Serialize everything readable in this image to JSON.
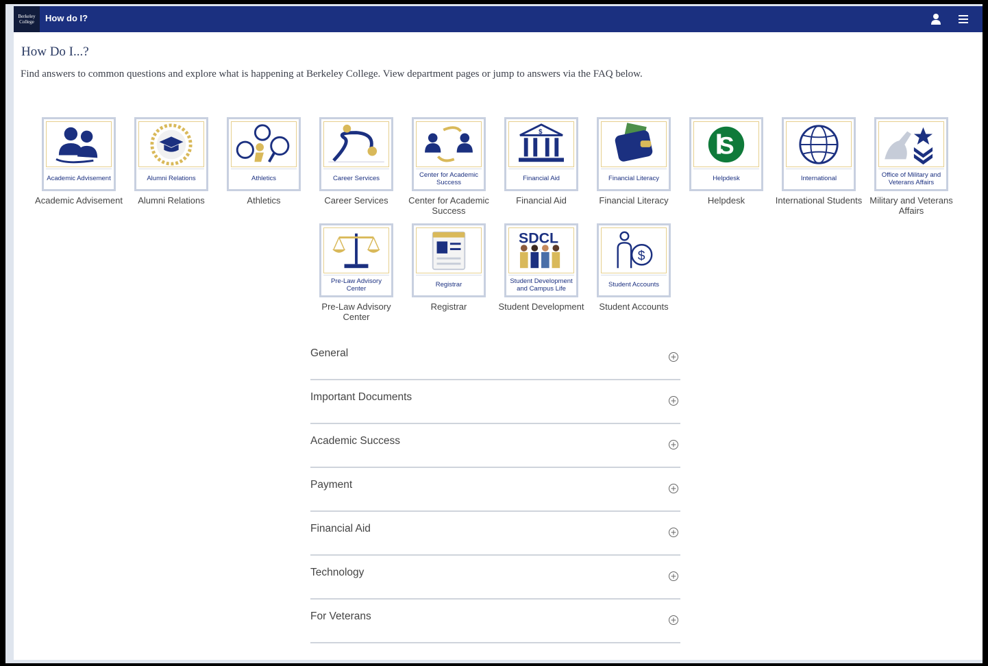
{
  "app": {
    "logo_text": "Berkeley College",
    "title": "How do I?"
  },
  "page": {
    "title": "How Do I...?",
    "description": "Find answers to common questions and explore what is happening at Berkeley College. View department pages or jump to answers via the FAQ below."
  },
  "tiles": [
    {
      "caption": "Academic Advisement",
      "label": "Academic Advisement",
      "icon": "people-icon"
    },
    {
      "caption": "Alumni Relations",
      "label": "Alumni Relations",
      "icon": "graduation-cap-icon"
    },
    {
      "caption": "Athletics",
      "label": "Athletics",
      "icon": "sports-balls-icon"
    },
    {
      "caption": "Career Services",
      "label": "Career Services",
      "icon": "career-path-icon"
    },
    {
      "caption": "Center for Academic Success",
      "label": "Center for Academic Success",
      "icon": "exchange-icon"
    },
    {
      "caption": "Financial Aid",
      "label": "Financial Aid",
      "icon": "bank-icon"
    },
    {
      "caption": "Financial Literacy",
      "label": "Financial Literacy",
      "icon": "wallet-icon"
    },
    {
      "caption": "Helpdesk",
      "label": "Helpdesk",
      "icon": "helpdesk-icon"
    },
    {
      "caption": "International",
      "label": "International Students",
      "icon": "globe-icon"
    },
    {
      "caption": "Office of Military and Veterans Affairs",
      "label": "Military and Veterans Affairs",
      "icon": "salute-star-icon"
    },
    {
      "caption": "Pre-Law Advisory Center",
      "label": "Pre-Law Advisory Center",
      "icon": "scales-icon"
    },
    {
      "caption": "Registrar",
      "label": "Registrar",
      "icon": "id-card-icon"
    },
    {
      "caption": "Student Development and Campus Life",
      "label": "Student Development",
      "icon": "sdcl-group-icon",
      "art_text": "SDCL"
    },
    {
      "caption": "Student Accounts",
      "label": "Student Accounts",
      "icon": "person-dollar-icon"
    }
  ],
  "faq": [
    {
      "title": "General"
    },
    {
      "title": "Important Documents"
    },
    {
      "title": "Academic Success"
    },
    {
      "title": "Payment"
    },
    {
      "title": "Financial Aid"
    },
    {
      "title": "Technology"
    },
    {
      "title": "For Veterans"
    }
  ],
  "colors": {
    "brand_navy": "#1b3080",
    "accent_gold": "#e6cf8e",
    "helpdesk_green": "#0f7a3a"
  }
}
